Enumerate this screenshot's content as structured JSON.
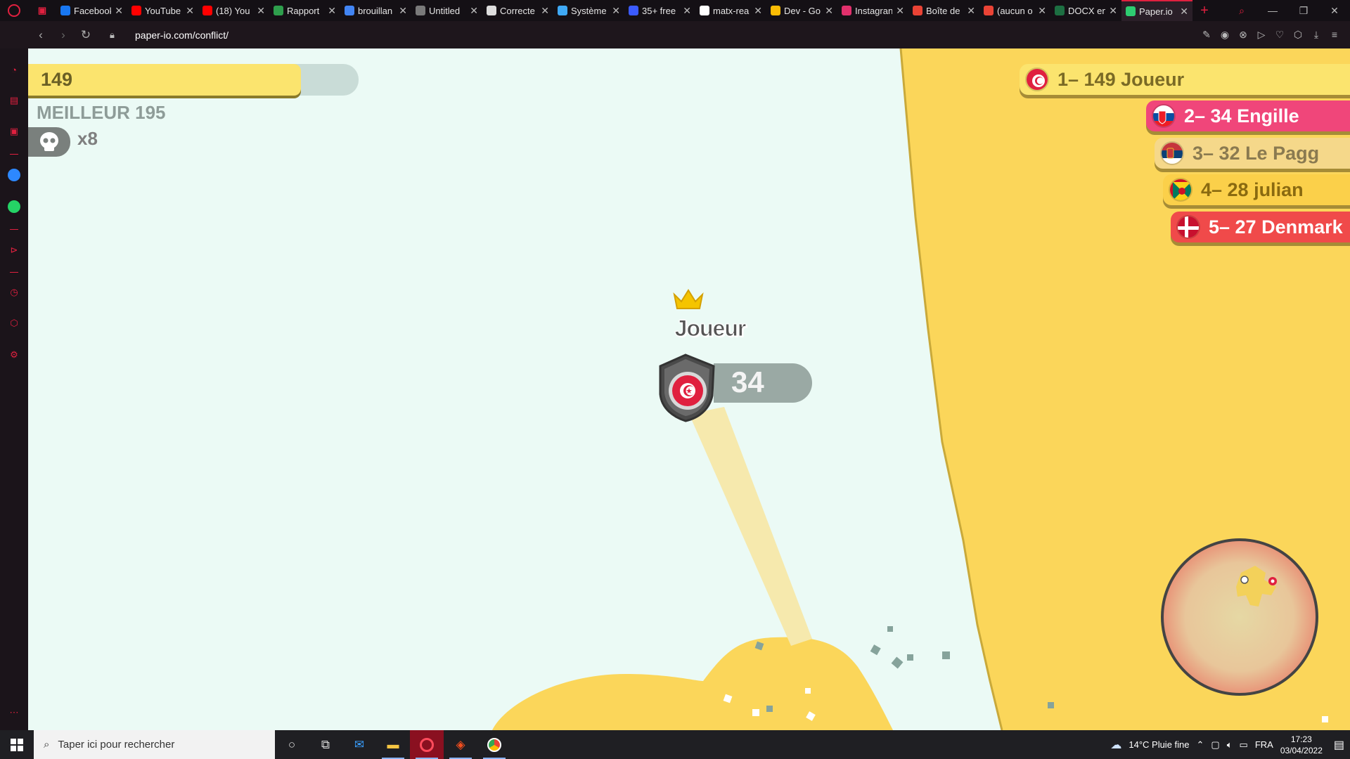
{
  "browser": {
    "tabs": [
      {
        "label": "Facebook",
        "icon": "facebook-icon",
        "color": "#1877f2"
      },
      {
        "label": "YouTube",
        "icon": "youtube-icon",
        "color": "#ff0000"
      },
      {
        "label": "(18) You",
        "icon": "youtube-icon",
        "color": "#ff0000"
      },
      {
        "label": "Rapport",
        "icon": "leaf-icon",
        "color": "#2e9e4c"
      },
      {
        "label": "brouillan",
        "icon": "docs-icon",
        "color": "#4285f4"
      },
      {
        "label": "Untitled",
        "icon": "globe-icon",
        "color": "#7a7a7a"
      },
      {
        "label": "Correcte",
        "icon": "link-icon",
        "color": "#dddddd"
      },
      {
        "label": "Système",
        "icon": "stripes-icon",
        "color": "#3fa9f5"
      },
      {
        "label": "35+ free",
        "icon": "diamond-icon",
        "color": "#3b5bff"
      },
      {
        "label": "matx-rea",
        "icon": "github-icon",
        "color": "#ffffff"
      },
      {
        "label": "Dev - Go",
        "icon": "drive-icon",
        "color": "#fbbc04"
      },
      {
        "label": "Instagran",
        "icon": "instagram-icon",
        "color": "#e1306c"
      },
      {
        "label": "Boîte de",
        "icon": "gmail-icon",
        "color": "#ea4335"
      },
      {
        "label": "(aucun o",
        "icon": "gmail-icon",
        "color": "#ea4335"
      },
      {
        "label": "DOCX en",
        "icon": "excel-icon",
        "color": "#1d6f42"
      },
      {
        "label": "Paper.io",
        "icon": "paperio-icon",
        "color": "#2ecc71"
      }
    ],
    "url": "paper-io.com/conflict/"
  },
  "game": {
    "score": "149",
    "best": "MEILLEUR 195",
    "kills": "x8",
    "player_name": "Joueur",
    "player_score": "34",
    "leaderboard": [
      {
        "text": "1– 149 Joueur",
        "bg": "#fbe46e",
        "fg": "#7a6a25",
        "flag": "tunisia"
      },
      {
        "text": "2– 34 Engille",
        "bg": "#f0467a",
        "fg": "#ffffff",
        "flag": "slovakia"
      },
      {
        "text": "3– 32 Le Pagg",
        "bg": "#f5d88a",
        "fg": "#8a7a50",
        "flag": "serbia"
      },
      {
        "text": "4– 28 julian",
        "bg": "#fbd04a",
        "fg": "#8a6a10",
        "flag": "grenada"
      },
      {
        "text": "5– 27 Denmark",
        "bg": "#f04a4a",
        "fg": "#ffffff",
        "flag": "denmark"
      }
    ]
  },
  "taskbar": {
    "search_placeholder": "Taper ici pour rechercher",
    "weather": "14°C Pluie fine",
    "lang": "FRA",
    "time": "17:23",
    "date": "03/04/2022"
  }
}
